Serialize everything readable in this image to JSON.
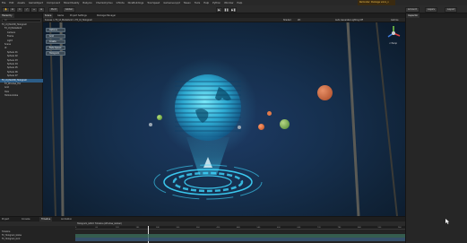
{
  "menubar": {
    "items": [
      "File",
      "Edit",
      "Assets",
      "GameObject",
      "Component",
      "Mixed Reality",
      "Babylon",
      "ChemistryVisu",
      "Infinite",
      "NiceBuildings",
      "ToonSpeed",
      "Gameover.ppt",
      "Tween",
      "Tools",
      "Help",
      "Python",
      "Window",
      "Help"
    ],
    "promo": "Reminder: Package v.bxx_n"
  },
  "toolbar": {
    "left_buttons": [
      "Hand",
      "Move",
      "Rotate",
      "Scale",
      "Rect",
      "Transform"
    ],
    "pivot": "Pivot",
    "global": "Global",
    "account": "Account",
    "layers": "Layers",
    "layout": "Layout"
  },
  "hierarchy": {
    "tabs": [
      "Hierarchy"
    ],
    "search_placeholder": "All",
    "items": [
      {
        "label": "FX_UI_Mod3D_Hologram",
        "indent": 0,
        "selected": false
      },
      {
        "label": "FX_UI_ModelGrid",
        "indent": 1,
        "selected": false
      },
      {
        "label": "Camera",
        "indent": 2,
        "selected": false
      },
      {
        "label": "Frame",
        "indent": 2,
        "selected": false
      },
      {
        "label": "Light",
        "indent": 2,
        "selected": false
      },
      {
        "label": "Scene",
        "indent": 1,
        "selected": false
      },
      {
        "label": "UI",
        "indent": 1,
        "selected": false
      },
      {
        "label": "Sphere 01",
        "indent": 2,
        "selected": false
      },
      {
        "label": "Sphere 02",
        "indent": 2,
        "selected": false
      },
      {
        "label": "Sphere 03",
        "indent": 2,
        "selected": false
      },
      {
        "label": "Sphere 04",
        "indent": 2,
        "selected": false
      },
      {
        "label": "Sphere 05",
        "indent": 2,
        "selected": false
      },
      {
        "label": "Sphere 06",
        "indent": 2,
        "selected": false
      },
      {
        "label": "Sphere 07",
        "indent": 2,
        "selected": false
      },
      {
        "label": "FX_UI_Mod3D_Hologram",
        "indent": 0,
        "selected": true
      },
      {
        "label": "FX_Window_Hol",
        "indent": 1,
        "selected": false
      },
      {
        "label": "Grid",
        "indent": 1,
        "selected": false
      },
      {
        "label": "Holo",
        "indent": 1,
        "selected": false
      },
      {
        "label": "Hollow Globe",
        "indent": 1,
        "selected": false
      }
    ]
  },
  "scene": {
    "tabs": [
      "Scene",
      "Game",
      "Project Settings",
      "Package Manager"
    ],
    "breadcrumb": "Scenes > FX_UI_ModelGrid > FX_UI_Hologram",
    "shading": "Shaded",
    "mode_2d": "2D",
    "gizmos": "Gizmos",
    "view_right": "Auto Generate Lighting Off",
    "persp": "< Persp",
    "holo_buttons": [
      "Options",
      "Grid",
      "Create",
      "Fade Speed",
      "Hologram"
    ]
  },
  "inspector": {
    "tabs": [
      "Inspector"
    ],
    "empty": ""
  },
  "bottom": {
    "tabs": [
      "Project",
      "Console",
      "Timeline",
      "Animation"
    ],
    "timeline_label": "Hologram_Glitch Timeline (Window_Global)",
    "tracks": [
      "Timeline",
      "FX_Hologram_Globe",
      "FX_Hologram_Grid"
    ],
    "ruler": [
      "0",
      "60",
      "120",
      "180",
      "240",
      "300",
      "360",
      "420",
      "480",
      "540",
      "600",
      "660",
      "720",
      "780",
      "840",
      "900",
      "960"
    ]
  },
  "colors": {
    "accent": "#2c5d87",
    "holo_cyan": "#3fd8ff",
    "bubble_orange": "#d9693b",
    "bubble_green": "#6fb54a",
    "promo_text": "#f0c04a"
  }
}
